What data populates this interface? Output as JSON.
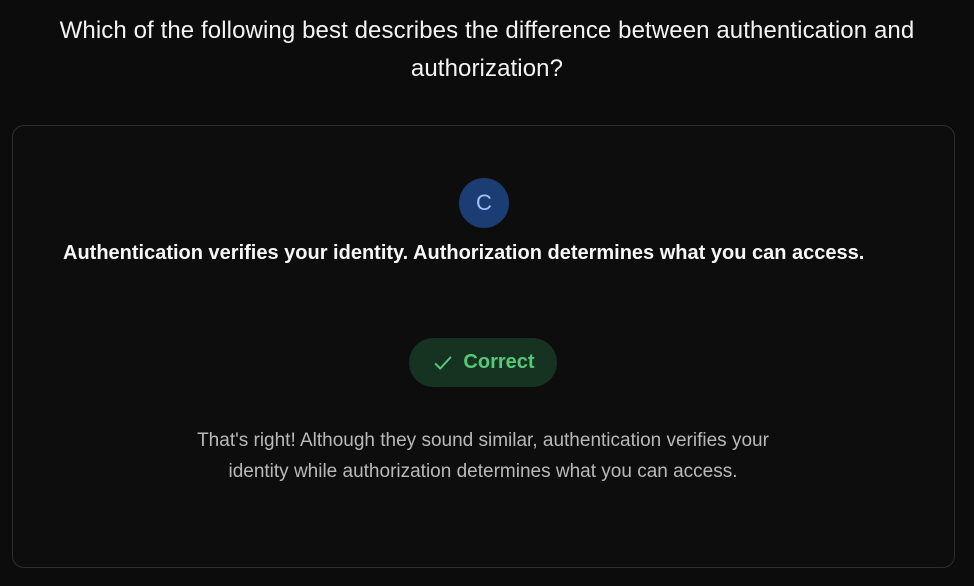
{
  "question": {
    "text": "Which of the following best describes the difference between authentication and authorization?"
  },
  "selected_answer": {
    "letter": "C",
    "text": "Authentication verifies your identity. Authorization determines what you can access."
  },
  "result": {
    "label": "Correct",
    "icon": "check-icon",
    "color": "#57c77a",
    "background": "#163220"
  },
  "feedback": {
    "text": "That's right! Although they sound similar, authentication verifies your identity while authorization determines what you can access."
  }
}
